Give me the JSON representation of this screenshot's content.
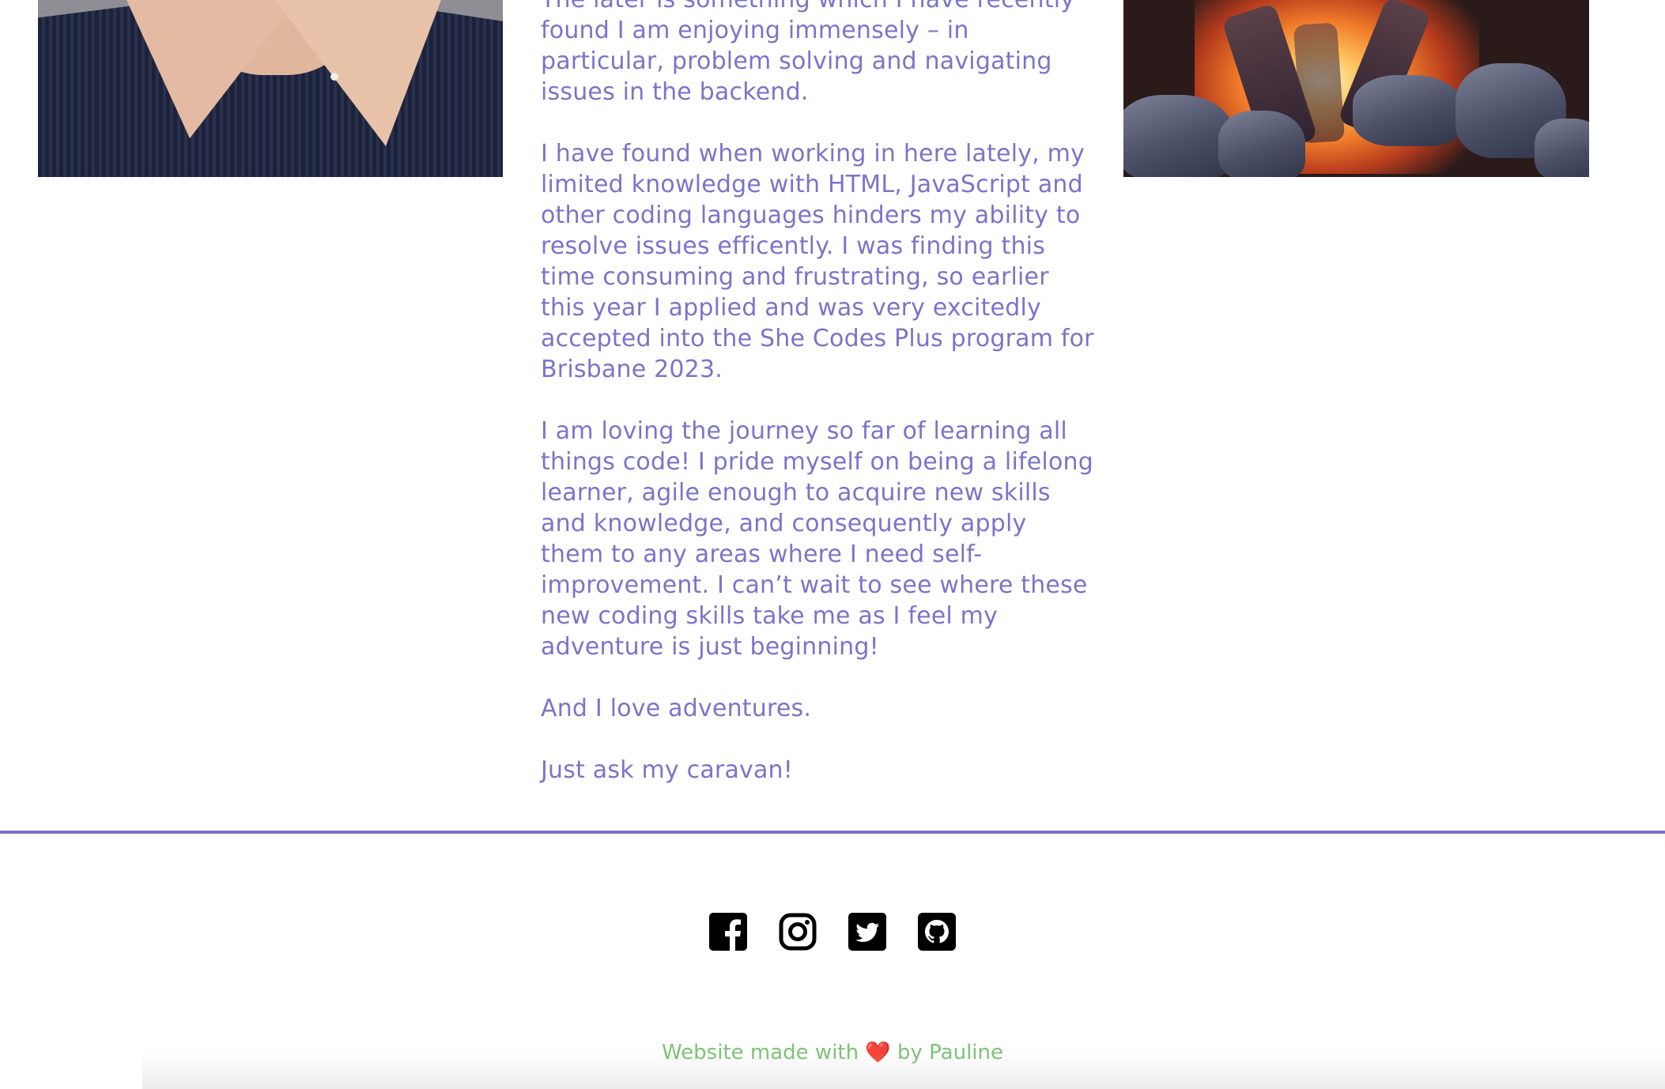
{
  "about": {
    "paragraphs": [
      "The later is something which I have recently found I am enjoying immensely – in particular, problem solving and navigating issues in the backend.",
      "I have found when working in here lately, my limited knowledge with HTML, JavaScript and other coding languages hinders my ability to resolve issues efficently. I was finding this time consuming and frustrating, so earlier this year I applied and was very excitedly accepted into the She Codes Plus program for Brisbane 2023.",
      "I am loving the journey so far of learning all things code! I pride myself on being a lifelong learner, agile enough to acquire new skills and knowledge, and consequently apply them to any areas where I need self-improvement. I can’t wait to see where these new coding skills take me as I feel my adventure is just beginning!",
      "And I love adventures.",
      "Just ask my caravan!"
    ]
  },
  "social": {
    "icons": [
      "facebook-icon",
      "instagram-icon",
      "twitter-icon",
      "github-icon"
    ]
  },
  "footer": {
    "prefix": "Website made with ",
    "heart": "❤️",
    "suffix": " by Pauline"
  },
  "colors": {
    "text": "#7b74c9",
    "divider": "#7b74c9",
    "footer": "#7cc274",
    "icons": "#000000"
  }
}
